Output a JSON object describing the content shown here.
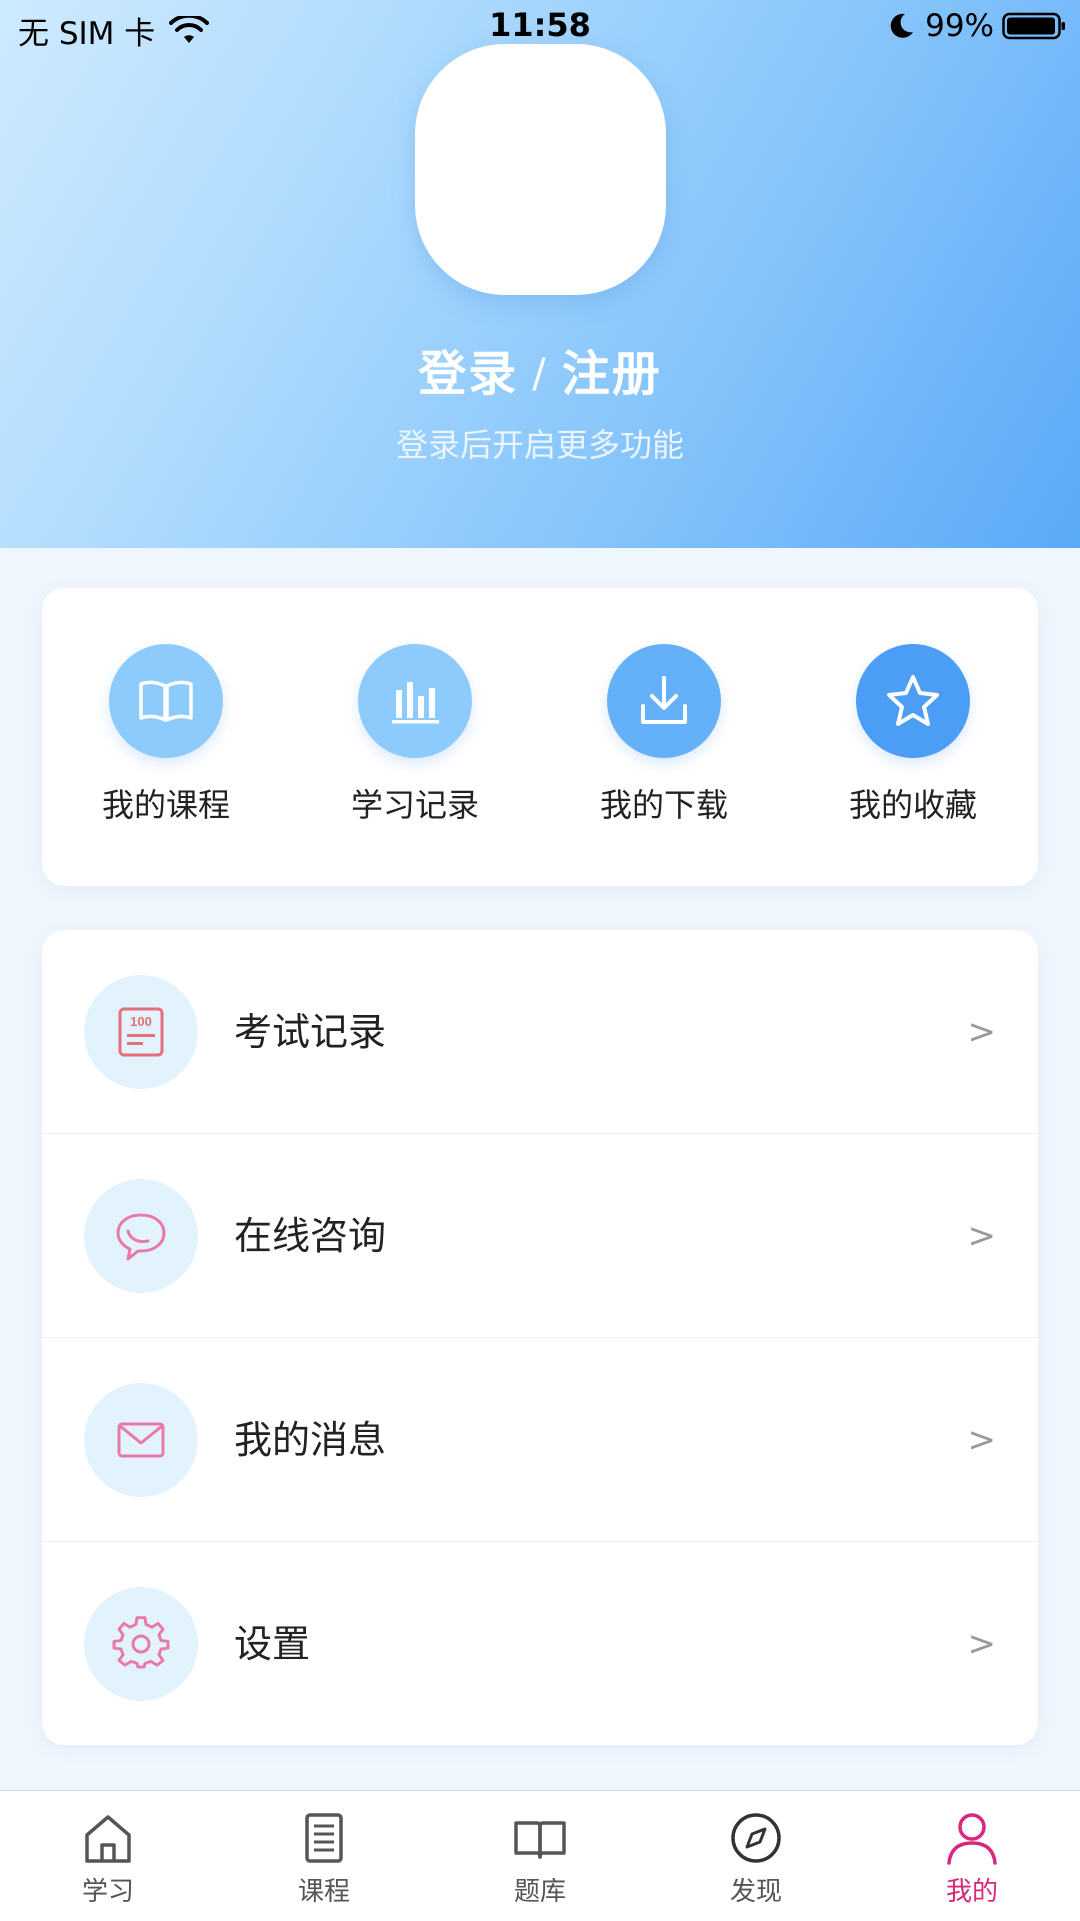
{
  "status_bar": {
    "carrier": "无 SIM 卡",
    "time": "11:58",
    "battery": "99%"
  },
  "profile": {
    "login": "登录",
    "separator": "/",
    "register": "注册",
    "subtitle": "登录后开启更多功能"
  },
  "quick_actions": [
    {
      "label": "我的课程",
      "icon": "open-book-icon",
      "color": "#8ccbfc"
    },
    {
      "label": "学习记录",
      "icon": "bar-chart-icon",
      "color": "#8ccbfc"
    },
    {
      "label": "我的下载",
      "icon": "download-icon",
      "color": "#65b1f9"
    },
    {
      "label": "我的收藏",
      "icon": "star-icon",
      "color": "#4c9df6"
    }
  ],
  "menu": [
    {
      "label": "考试记录",
      "icon": "exam-score-icon",
      "arrow": ">"
    },
    {
      "label": "在线咨询",
      "icon": "chat-bubble-icon",
      "arrow": ">"
    },
    {
      "label": "我的消息",
      "icon": "envelope-icon",
      "arrow": ">"
    },
    {
      "label": "设置",
      "icon": "gear-icon",
      "arrow": ">"
    }
  ],
  "tabs": [
    {
      "label": "学习",
      "icon": "home-icon"
    },
    {
      "label": "课程",
      "icon": "document-icon"
    },
    {
      "label": "题库",
      "icon": "book-icon"
    },
    {
      "label": "发现",
      "icon": "compass-icon"
    },
    {
      "label": "我的",
      "icon": "user-icon",
      "active": true
    }
  ],
  "colors": {
    "accent_pink": "#d8287d",
    "menu_icon_pink": "#e879a8",
    "menu_icon_bg": "#e3f3fd"
  }
}
